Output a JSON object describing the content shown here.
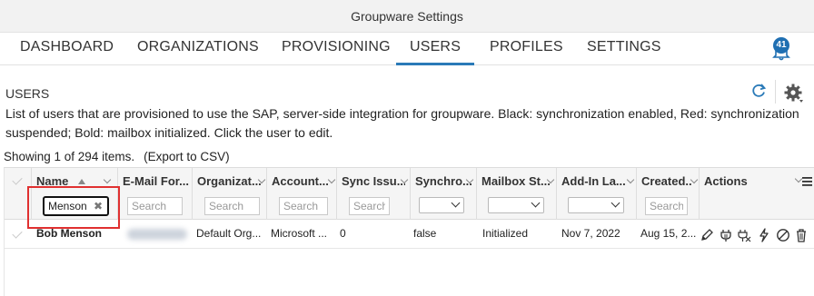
{
  "window": {
    "title": "Groupware Settings"
  },
  "nav": {
    "tabs": [
      {
        "label": "DASHBOARD"
      },
      {
        "label": "ORGANIZATIONS"
      },
      {
        "label": "PROVISIONING"
      },
      {
        "label": "USERS",
        "active": true
      },
      {
        "label": "PROFILES"
      },
      {
        "label": "SETTINGS"
      }
    ],
    "notifications": {
      "count": "41",
      "icon": "bell-icon"
    }
  },
  "section": {
    "title": "USERS",
    "description": "List of users that are provisioned to use the SAP, server-side integration for groupware. Black: synchronization enabled, Red: synchronization suspended; Bold: mailbox initialized. Click the user to edit."
  },
  "status": {
    "showing": "Showing 1 of 294 items.",
    "export": "(Export to CSV)"
  },
  "table": {
    "columns": [
      {
        "title": "Name",
        "filter_value": "Menson",
        "sorted": "ascending"
      },
      {
        "title": "E-Mail For...",
        "placeholder": "Search"
      },
      {
        "title": "Organizat...",
        "placeholder": "Search"
      },
      {
        "title": "Account...",
        "placeholder": "Search"
      },
      {
        "title": "Sync Issu...",
        "placeholder": "Search"
      },
      {
        "title": "Synchro...",
        "select": true
      },
      {
        "title": "Mailbox St...",
        "select": true
      },
      {
        "title": "Add-In La...",
        "select": true
      },
      {
        "title": "Created...",
        "placeholder": "Search"
      },
      {
        "title": "Actions"
      }
    ],
    "rows": [
      {
        "name": "Bob Menson",
        "organization": "Default Org...",
        "account": "Microsoft ...",
        "sync_issues": "0",
        "synchronization": "false",
        "mailbox_status": "Initialized",
        "addin_last": "Nov 7, 2022",
        "created": "Aug 15, 2...",
        "actions": [
          "pencil-icon",
          "plug-icon",
          "plug-settings-icon",
          "lightning-icon",
          "block-icon",
          "trash-icon"
        ]
      }
    ]
  },
  "colors": {
    "accent": "#2a7ab8",
    "highlight": "#e03030",
    "badge": "#1f6fb2"
  }
}
